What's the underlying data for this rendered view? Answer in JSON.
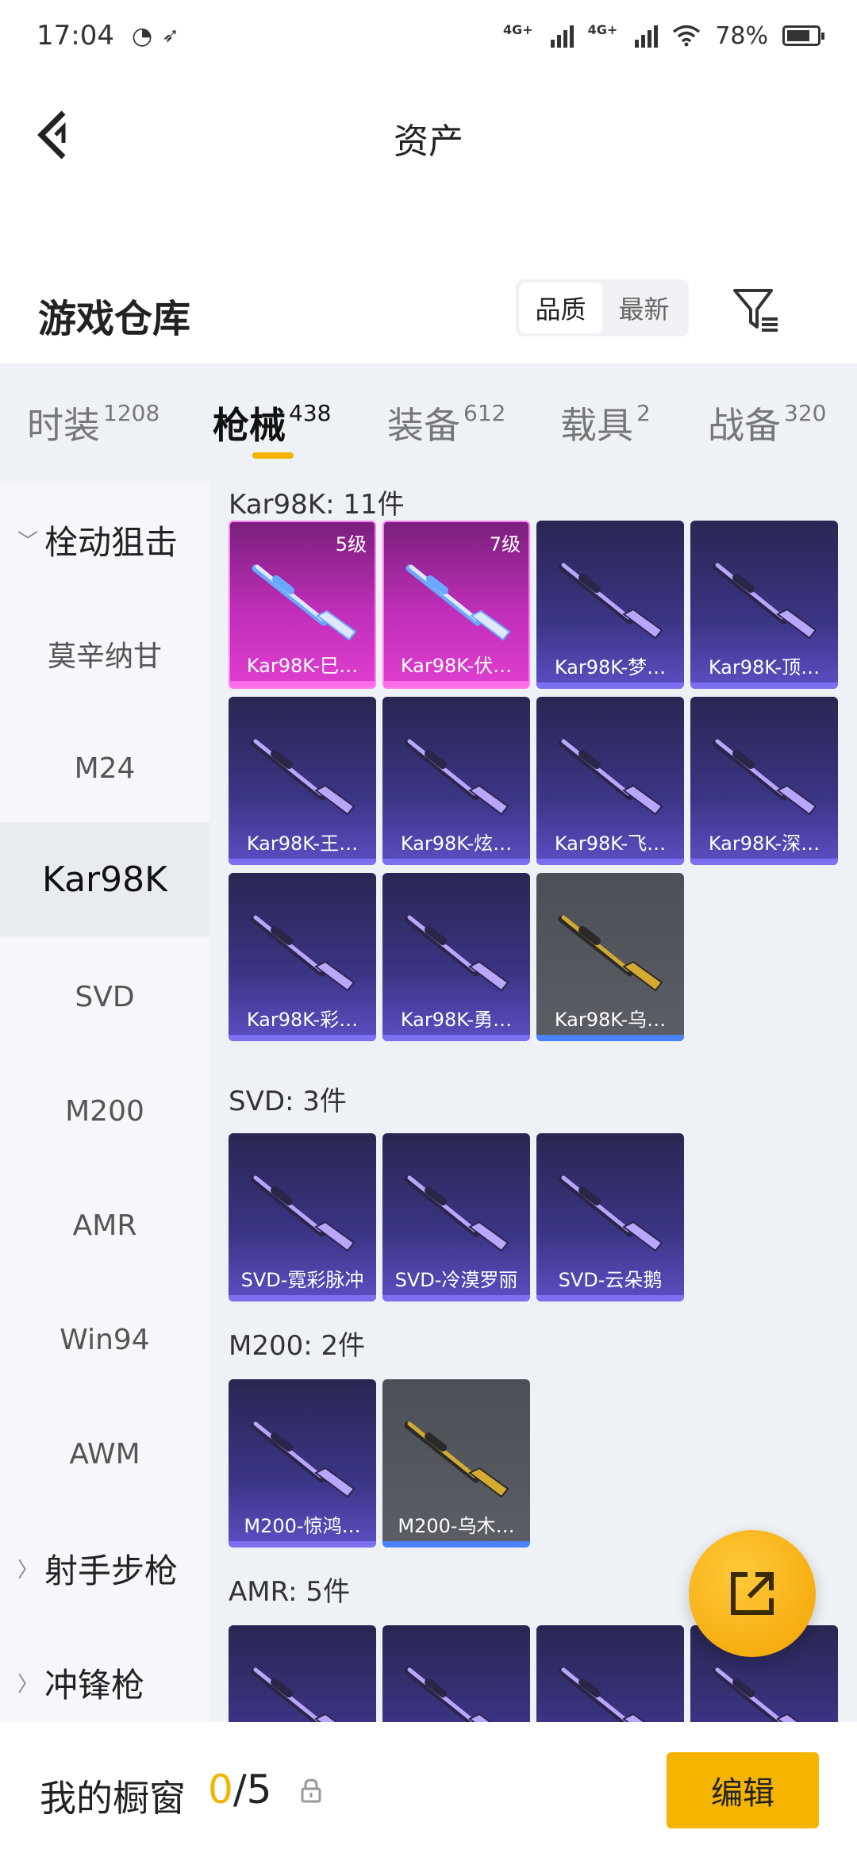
{
  "status_bar": {
    "time": "17:04",
    "network1": "4G+",
    "network2": "4G+",
    "battery": "78%",
    "battery_level": 0.78
  },
  "header": {
    "title": "资产"
  },
  "warehouse": {
    "title": "游戏仓库",
    "sort_quality": "品质",
    "sort_newest": "最新"
  },
  "tabs": [
    {
      "label": "时装",
      "count": "1208"
    },
    {
      "label": "枪械",
      "count": "438"
    },
    {
      "label": "装备",
      "count": "612"
    },
    {
      "label": "载具",
      "count": "2"
    },
    {
      "label": "战备",
      "count": "320"
    }
  ],
  "sidebar": {
    "items": [
      {
        "label": "栓动狙击",
        "type": "group-open"
      },
      {
        "label": "莫辛纳甘"
      },
      {
        "label": "M24"
      },
      {
        "label": "Kar98K"
      },
      {
        "label": "SVD"
      },
      {
        "label": "M200"
      },
      {
        "label": "AMR"
      },
      {
        "label": "Win94"
      },
      {
        "label": "AWM"
      },
      {
        "label": "射手步枪",
        "type": "group-closed"
      },
      {
        "label": "冲锋枪",
        "type": "group-closed"
      }
    ]
  },
  "sections": [
    {
      "title": "Kar98K: 11件",
      "items": [
        {
          "name": "Kar98K-巳…",
          "level": "5级",
          "rarity": "pink"
        },
        {
          "name": "Kar98K-伏…",
          "level": "7级",
          "rarity": "pink"
        },
        {
          "name": "Kar98K-梦…",
          "rarity": "purple"
        },
        {
          "name": "Kar98K-顶…",
          "rarity": "purple"
        },
        {
          "name": "Kar98K-王…",
          "rarity": "purple"
        },
        {
          "name": "Kar98K-炫…",
          "rarity": "purple"
        },
        {
          "name": "Kar98K-飞…",
          "rarity": "purple"
        },
        {
          "name": "Kar98K-深…",
          "rarity": "purple"
        },
        {
          "name": "Kar98K-彩…",
          "rarity": "purple"
        },
        {
          "name": "Kar98K-勇…",
          "rarity": "purple"
        },
        {
          "name": "Kar98K-乌…",
          "rarity": "gray"
        }
      ]
    },
    {
      "title": "SVD: 3件",
      "items": [
        {
          "name": "SVD-霓彩脉冲",
          "rarity": "purple"
        },
        {
          "name": "SVD-冷漠罗丽",
          "rarity": "purple"
        },
        {
          "name": "SVD-云朵鹅",
          "rarity": "purple"
        }
      ]
    },
    {
      "title": "M200: 2件",
      "items": [
        {
          "name": "M200-惊鸿…",
          "rarity": "purple"
        },
        {
          "name": "M200-乌木…",
          "rarity": "gray"
        }
      ]
    },
    {
      "title": "AMR: 5件",
      "items": [
        {
          "name": "",
          "rarity": "purple"
        },
        {
          "name": "",
          "rarity": "purple"
        },
        {
          "name": "",
          "rarity": "purple"
        },
        {
          "name": "",
          "rarity": "purple"
        }
      ]
    }
  ],
  "showcase": {
    "label": "我的橱窗",
    "current": "0",
    "separator_total": "/5",
    "edit_label": "编辑"
  },
  "colors": {
    "accent": "#f5b400",
    "pink_rarity": "#e03ed0",
    "purple_rarity": "#5c4fc4",
    "gray_rarity": "#5c5e66"
  },
  "icons": [
    "back-arrow-icon",
    "filter-icon",
    "chevron-down-icon",
    "chevron-right-icon",
    "share-export-icon",
    "lock-icon",
    "wifi-icon",
    "battery-icon"
  ]
}
